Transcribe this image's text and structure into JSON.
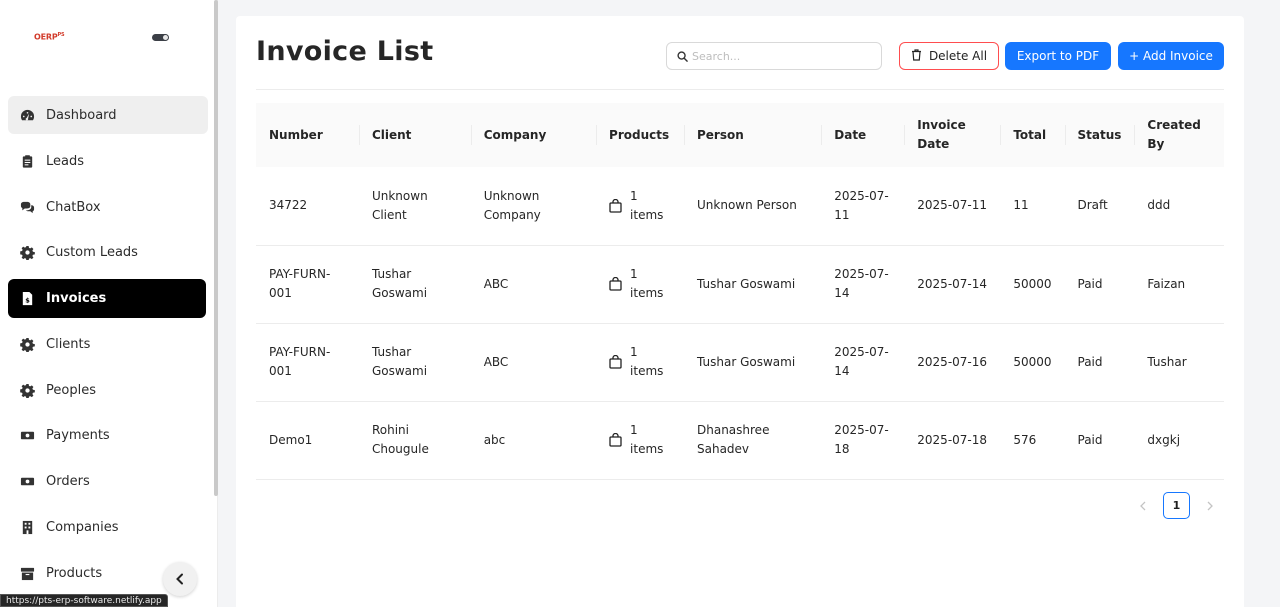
{
  "sidebar": {
    "logo_text": "OERP",
    "logo_sup": "PS",
    "items": [
      {
        "label": "Dashboard",
        "icon": "dashboard-icon"
      },
      {
        "label": "Leads",
        "icon": "clipboard-icon"
      },
      {
        "label": "ChatBox",
        "icon": "chat-icon"
      },
      {
        "label": "Custom Leads",
        "icon": "gear-icon"
      },
      {
        "label": "Invoices",
        "icon": "invoice-icon"
      },
      {
        "label": "Clients",
        "icon": "gear-icon"
      },
      {
        "label": "Peoples",
        "icon": "gear-icon"
      },
      {
        "label": "Payments",
        "icon": "money-icon"
      },
      {
        "label": "Orders",
        "icon": "money-icon"
      },
      {
        "label": "Companies",
        "icon": "building-icon"
      },
      {
        "label": "Products",
        "icon": "box-icon"
      }
    ],
    "active_item": "Invoices",
    "url_tooltip": "https://pts-erp-software.netlify.app"
  },
  "header": {
    "title": "Invoice List",
    "search_placeholder": "Search...",
    "delete_all_label": "Delete All",
    "export_label": "Export to PDF",
    "add_label": "+ Add Invoice"
  },
  "table": {
    "columns": [
      "Number",
      "Client",
      "Company",
      "Products",
      "Person",
      "Date",
      "Invoice Date",
      "Total",
      "Status",
      "Created By"
    ],
    "rows": [
      {
        "number": "34722",
        "client": "Unknown Client",
        "company": "Unknown Company",
        "products": "1 items",
        "person": "Unknown Person",
        "date": "2025-07-11",
        "invoice_date": "2025-07-11",
        "total": "11",
        "status": "Draft",
        "created_by": "ddd"
      },
      {
        "number": "PAY-FURN-001",
        "client": "Tushar Goswami",
        "company": "ABC",
        "products": "1 items",
        "person": "Tushar Goswami",
        "date": "2025-07-14",
        "invoice_date": "2025-07-14",
        "total": "50000",
        "status": "Paid",
        "created_by": "Faizan"
      },
      {
        "number": "PAY-FURN-001",
        "client": "Tushar Goswami",
        "company": "ABC",
        "products": "1 items",
        "person": "Tushar Goswami",
        "date": "2025-07-14",
        "invoice_date": "2025-07-16",
        "total": "50000",
        "status": "Paid",
        "created_by": "Tushar"
      },
      {
        "number": "Demo1",
        "client": "Rohini Chougule",
        "company": "abc",
        "products": "1 items",
        "person": "Dhanashree Sahadev",
        "date": "2025-07-18",
        "invoice_date": "2025-07-18",
        "total": "576",
        "status": "Paid",
        "created_by": "dxgkj"
      }
    ]
  },
  "pagination": {
    "current_page": "1",
    "prev_icon": "chevron-left-icon",
    "next_icon": "chevron-right-icon"
  },
  "colors": {
    "primary": "#1677ff",
    "danger": "#ff4d4f",
    "active_nav_bg": "#000000"
  }
}
